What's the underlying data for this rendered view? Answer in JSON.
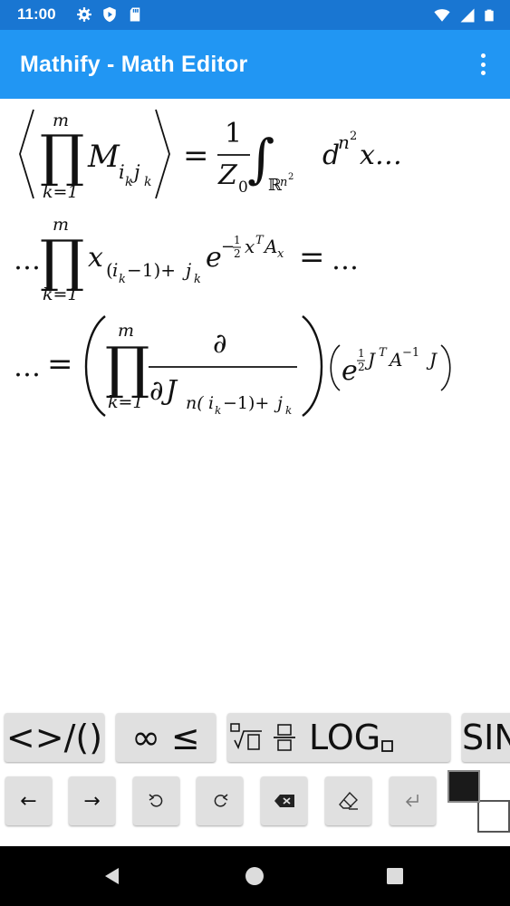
{
  "status_bar": {
    "time": "11:00",
    "left_icons": [
      "settings-icon",
      "shield-icon",
      "sd-card-icon"
    ],
    "right_icons": [
      "wifi-icon",
      "signal-icon",
      "battery-icon"
    ]
  },
  "app_bar": {
    "title": "Mathify - Math Editor",
    "overflow_icon": "more-vert-icon"
  },
  "math": {
    "expression_latex": "\\left\\langle\\prod_{k=1}^{m} M_{i_k j_k}\\right\\rangle = \\frac{1}{Z_0}\\int_{\\mathbb{R}^{n^2}} d^{n^2}x \\ldots \\ldots \\prod_{k=1}^{m} x_{(i_k-1)+j_k} e^{-\\frac{1}{2}x^T A_x} = \\ldots \\ldots = \\left(\\prod_{k=1}^{m}\\frac{\\partial}{\\partial J_{n(i_k-1)+j_k}}\\right)\\left(e^{\\frac{1}{2}J^T A^{-1} J}\\right)",
    "glyphs": {
      "ellipsis": "…",
      "ellipsis_tail": "x…",
      "product": "∏",
      "k_eq_1": "k=1",
      "m": "m",
      "M": "M",
      "i": "i",
      "k": "k",
      "j": "j",
      "equals": "=",
      "one": "1",
      "Z": "Z",
      "zero": "0",
      "integral": "∫",
      "R": "ℝ",
      "n": "n",
      "two": "2",
      "d": "d",
      "x": "x",
      "open_paren": "(",
      "close_paren": ")",
      "minus_one_paren": "−1)+",
      "e": "e",
      "minus": "−",
      "T": "T",
      "A": "A",
      "partial": "∂",
      "J": "J",
      "n_open": "n(",
      "minus_one_close": "−1)+",
      "inv": "−1"
    }
  },
  "keyboard": {
    "row1": [
      {
        "label": "<>/()",
        "name": "brackets-key"
      },
      {
        "label": "∞ ≤",
        "name": "symbols-key"
      },
      {
        "label": "LOG",
        "name": "functions-key",
        "icons": [
          "root-template-icon",
          "fraction-template-icon",
          "subscript-box-icon"
        ]
      },
      {
        "label": "SIN",
        "name": "trig-key"
      }
    ],
    "row2": [
      {
        "name": "cursor-left-key",
        "glyph": "←"
      },
      {
        "name": "cursor-right-key",
        "glyph": "→"
      },
      {
        "name": "undo-key",
        "icon": "undo-icon"
      },
      {
        "name": "redo-key",
        "icon": "redo-icon"
      },
      {
        "name": "backspace-key",
        "icon": "backspace-icon"
      },
      {
        "name": "clear-key",
        "icon": "eraser-icon"
      },
      {
        "name": "enter-key",
        "icon": "return-icon"
      }
    ],
    "colors": {
      "foreground": "#1a1a1a",
      "background": "#ffffff"
    }
  },
  "nav_bar": {
    "buttons": [
      "back-icon",
      "home-icon",
      "recents-icon"
    ]
  },
  "theme": {
    "primary": "#2196f3",
    "primary_dark": "#1976d2",
    "key_background": "#e0e0e0"
  }
}
